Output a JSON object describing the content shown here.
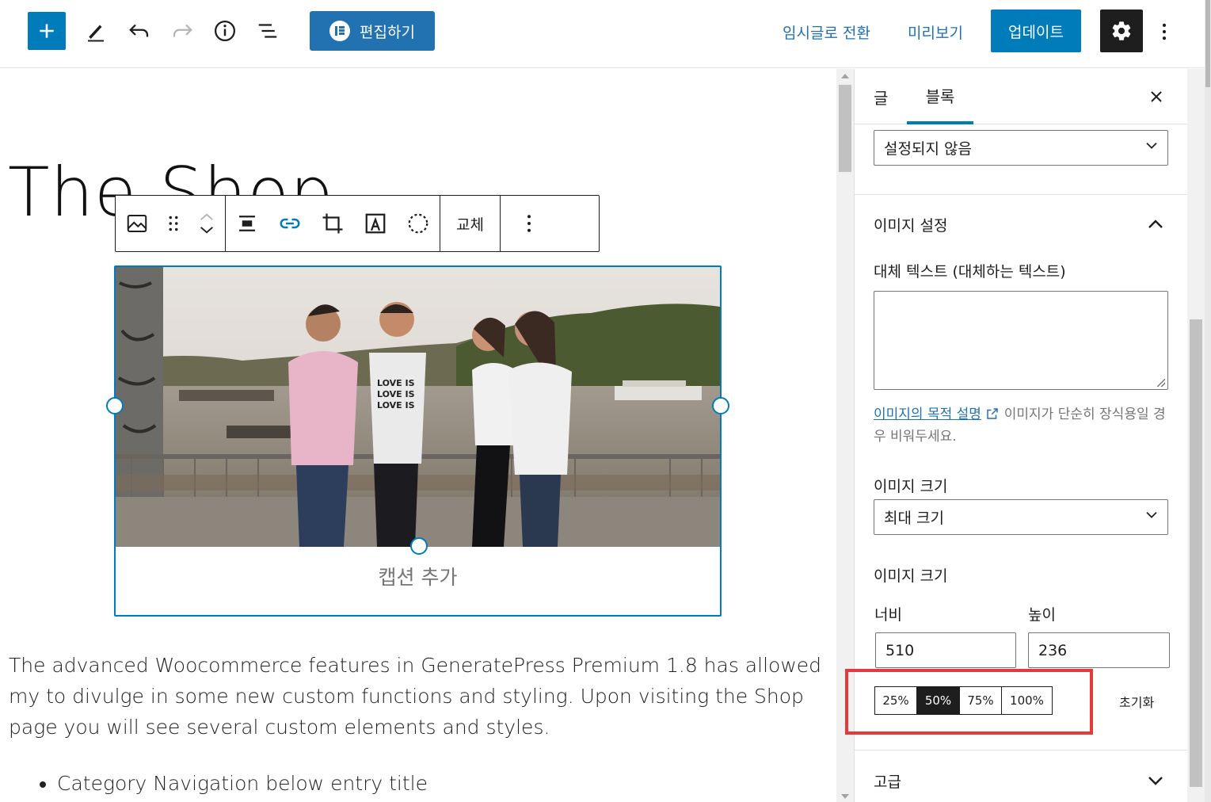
{
  "toolbar": {
    "elementor_label": "편집하기",
    "switch_draft_label": "임시글로 전환",
    "preview_label": "미리보기",
    "update_label": "업데이트"
  },
  "post": {
    "title": "The Shop",
    "image_caption_placeholder": "캡션 추가",
    "paragraph": "The advanced Woocommerce features in GeneratePress Premium 1.8 has allowed my to divulge in some new custom functions and styling. Upon visiting the Shop page you will see several custom elements and styles.",
    "list_items": [
      "Category Navigation below entry title"
    ]
  },
  "block_toolbar": {
    "replace_label": "교체"
  },
  "sidebar": {
    "tabs": {
      "post": "글",
      "block": "블록"
    },
    "align_select_value": "설정되지 않음",
    "image_settings_title": "이미지 설정",
    "alt_text_label": "대체 텍스트 (대체하는 텍스트)",
    "alt_text_value": "",
    "alt_help_link": "이미지의 목적 설명",
    "alt_help_text": "이미지가 단순히 장식용일 경우 비워두세요.",
    "image_size_label": "이미지 크기",
    "image_size_value": "최대 크기",
    "image_dimensions_label": "이미지 크기",
    "width_label": "너비",
    "width_value": "510",
    "height_label": "높이",
    "height_value": "236",
    "percent_options": [
      "25%",
      "50%",
      "75%",
      "100%"
    ],
    "percent_selected": "50%",
    "reset_label": "초기화",
    "advanced_title": "고급"
  },
  "colors": {
    "accent": "#007cba",
    "highlight_border": "#e33b3b"
  }
}
